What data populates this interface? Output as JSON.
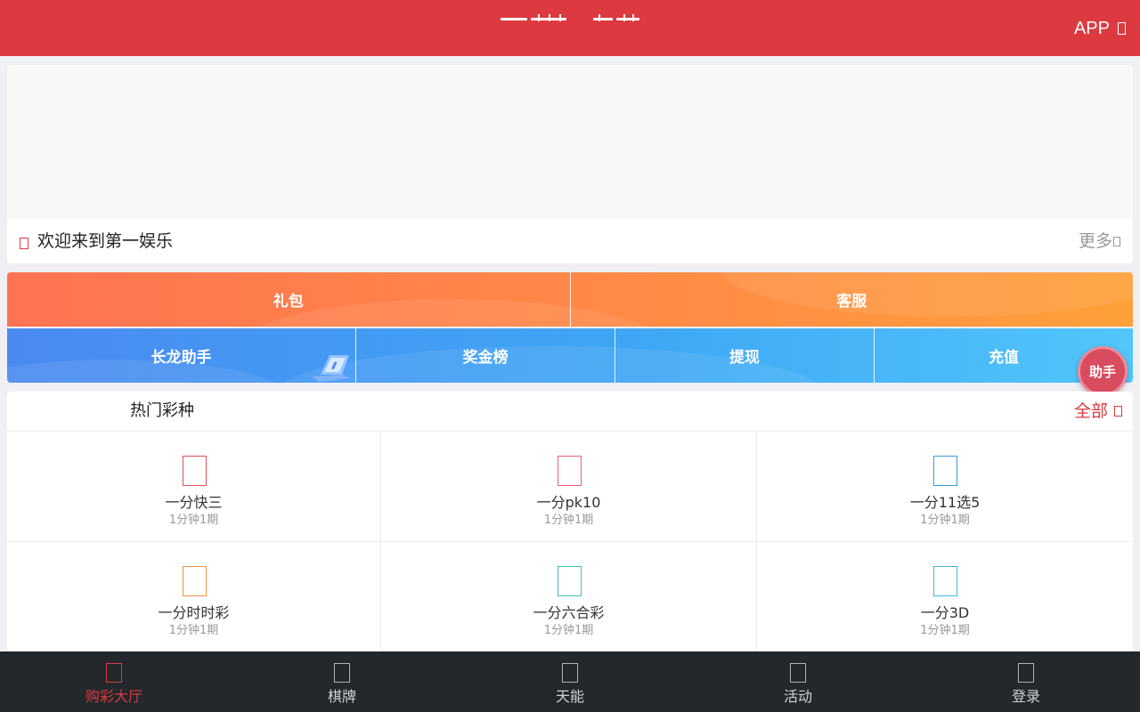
{
  "header": {
    "app_label": "APP",
    "brand_color": "#dc3a40"
  },
  "banner": {
    "notice_icon": "speaker-icon",
    "notice_text": "欢迎来到第一娱乐",
    "more_label": "更多"
  },
  "quick_links": {
    "row1": [
      {
        "label": "礼包",
        "icon": "gift-icon"
      },
      {
        "label": "客服",
        "icon": "customer-service-icon"
      }
    ],
    "row2": [
      {
        "label": "长龙助手",
        "icon": "laptop-icon"
      },
      {
        "label": "奖金榜"
      },
      {
        "label": "提现"
      },
      {
        "label": "充值"
      }
    ]
  },
  "helper_fab": {
    "label": "助手"
  },
  "hot_games": {
    "title": "热门彩种",
    "all_label": "全部",
    "items": [
      {
        "name": "一分快三",
        "sub": "1分钟1期",
        "color": "#e0505a"
      },
      {
        "name": "一分pk10",
        "sub": "1分钟1期",
        "color": "#e8607a"
      },
      {
        "name": "一分11选5",
        "sub": "1分钟1期",
        "color": "#3a9ee0"
      },
      {
        "name": "一分时时彩",
        "sub": "1分钟1期",
        "color": "#f09040"
      },
      {
        "name": "一分六合彩",
        "sub": "1分钟1期",
        "color": "#40c0b0"
      },
      {
        "name": "一分3D",
        "sub": "1分钟1期",
        "color": "#40b8e0"
      }
    ]
  },
  "tabbar": {
    "active_color": "#dc3a40",
    "items": [
      {
        "label": "购彩大厅",
        "icon": "lottery-hall-icon",
        "active": true
      },
      {
        "label": "棋牌",
        "icon": "cards-icon"
      },
      {
        "label": "天能",
        "icon": "energy-icon"
      },
      {
        "label": "活动",
        "icon": "activity-icon"
      },
      {
        "label": "登录",
        "icon": "user-icon"
      }
    ]
  }
}
